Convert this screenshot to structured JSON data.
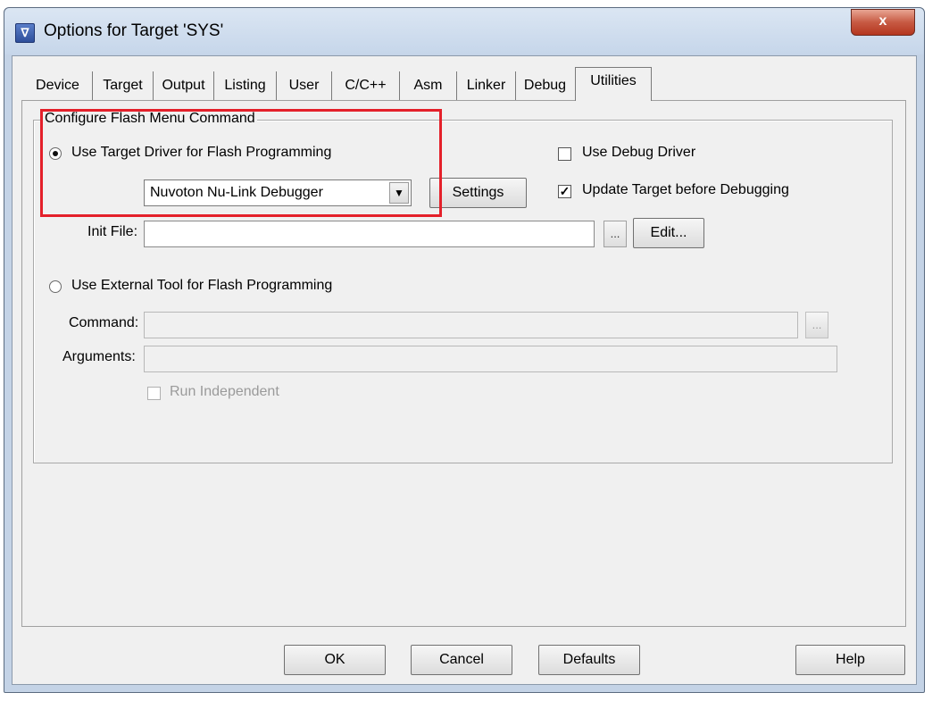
{
  "window": {
    "title": "Options for Target 'SYS'",
    "close_glyph": "x"
  },
  "tabs": [
    {
      "label": "Device"
    },
    {
      "label": "Target"
    },
    {
      "label": "Output"
    },
    {
      "label": "Listing"
    },
    {
      "label": "User"
    },
    {
      "label": "C/C++"
    },
    {
      "label": "Asm"
    },
    {
      "label": "Linker"
    },
    {
      "label": "Debug"
    },
    {
      "label": "Utilities",
      "active": true
    }
  ],
  "flash": {
    "group_label": "Configure Flash Menu Command",
    "use_target_driver_label": "Use Target Driver for Flash Programming",
    "use_target_driver_selected": true,
    "driver_select": {
      "value": "Nuvoton Nu-Link Debugger"
    },
    "settings_label": "Settings",
    "use_debug_driver_label": "Use Debug Driver",
    "use_debug_driver_checked": false,
    "update_target_label": "Update Target before Debugging",
    "update_target_checked": true,
    "init_file_label": "Init File:",
    "init_file_value": "",
    "browse_label": "...",
    "edit_label": "Edit...",
    "use_external_tool_label": "Use External Tool for Flash Programming",
    "use_external_tool_selected": false,
    "command_label": "Command:",
    "command_value": "",
    "arguments_label": "Arguments:",
    "arguments_value": "",
    "run_independent_label": "Run Independent",
    "run_independent_checked": false
  },
  "footer": {
    "ok_label": "OK",
    "cancel_label": "Cancel",
    "defaults_label": "Defaults",
    "help_label": "Help"
  },
  "colors": {
    "highlight_box": "#e4202a",
    "dialog_face": "#f0f0f0"
  }
}
